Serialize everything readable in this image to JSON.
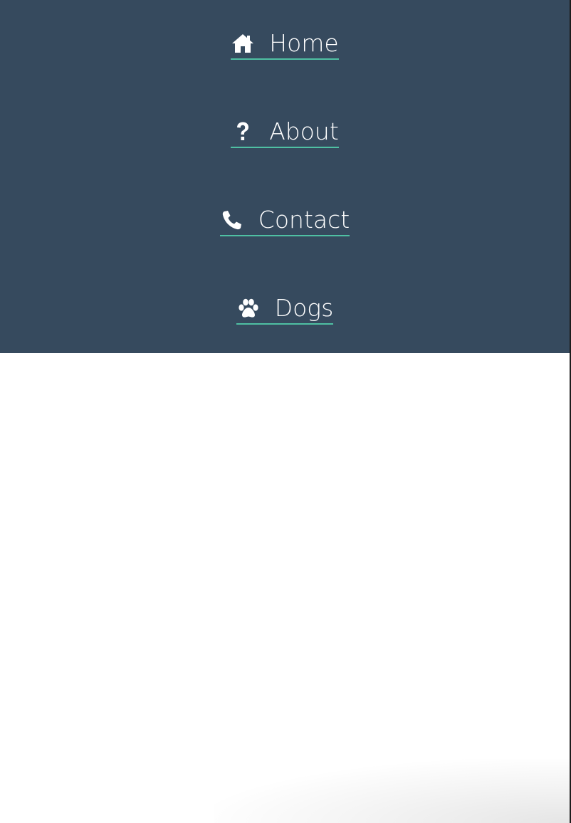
{
  "nav": {
    "background_color": "#364a5e",
    "underline_color": "#4fc0a3",
    "text_color": "#ffffff",
    "items": [
      {
        "label": "Home",
        "icon": "home-icon"
      },
      {
        "label": "About",
        "icon": "question-icon"
      },
      {
        "label": "Contact",
        "icon": "phone-icon"
      },
      {
        "label": "Dogs",
        "icon": "paw-icon"
      }
    ]
  }
}
